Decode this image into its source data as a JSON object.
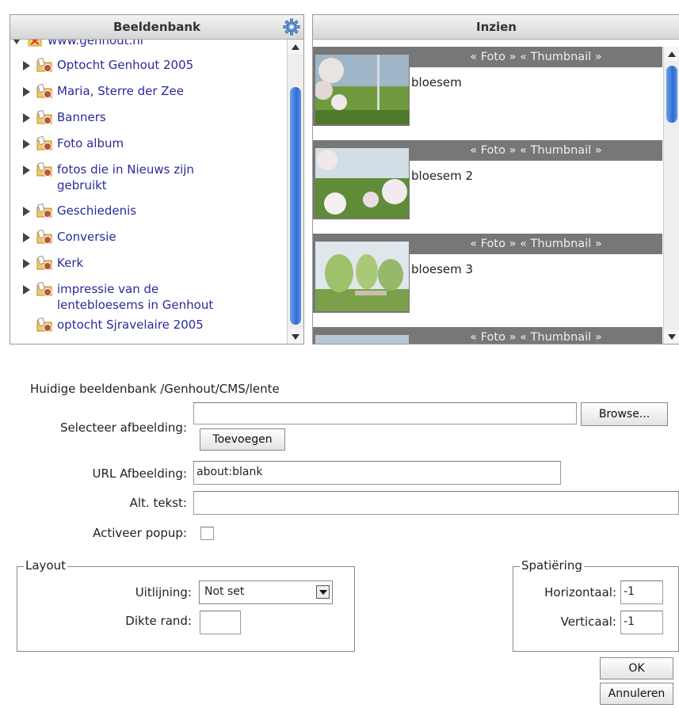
{
  "library_panel": {
    "title": "Beeldenbank",
    "root": "www.genhout.nl",
    "items": [
      {
        "label": "Optocht Genhout 2005",
        "expandable": true
      },
      {
        "label": "Maria, Sterre der Zee",
        "expandable": true
      },
      {
        "label": "Banners",
        "expandable": true
      },
      {
        "label": "Foto album",
        "expandable": true
      },
      {
        "label": "fotos die in Nieuws zijn gebruikt",
        "expandable": true
      },
      {
        "label": "Geschiedenis",
        "expandable": true
      },
      {
        "label": "Conversie",
        "expandable": true
      },
      {
        "label": "Kerk",
        "expandable": true
      },
      {
        "label": "impressie van de lentebloesems in Genhout",
        "expandable": true
      },
      {
        "label": "optocht Sjravelaire 2005",
        "expandable": false
      }
    ]
  },
  "preview_panel": {
    "title": "Inzien",
    "bar_label": "« Foto » « Thumbnail »",
    "images": [
      {
        "caption": "bloesem"
      },
      {
        "caption": "bloesem 2"
      },
      {
        "caption": "bloesem 3"
      },
      {
        "caption": ""
      }
    ]
  },
  "form": {
    "current_library": "Huidige beeldenbank /Genhout/CMS/lente",
    "select_image_label": "Selecteer afbeelding:",
    "browse_button": "Browse...",
    "add_button": "Toevoegen",
    "url_label": "URL Afbeelding:",
    "url_value": "about:blank",
    "alt_label": "Alt. tekst:",
    "alt_value": "",
    "popup_label": "Activeer popup:",
    "layout": {
      "legend": "Layout",
      "align_label": "Uitlijning:",
      "align_value": "Not set",
      "border_label": "Dikte rand:",
      "border_value": ""
    },
    "spacing": {
      "legend": "Spatiëring",
      "horizontal_label": "Horizontaal:",
      "horizontal_value": "-1",
      "vertical_label": "Verticaal:",
      "vertical_value": "-1"
    },
    "ok_button": "OK",
    "cancel_button": "Annuleren"
  }
}
